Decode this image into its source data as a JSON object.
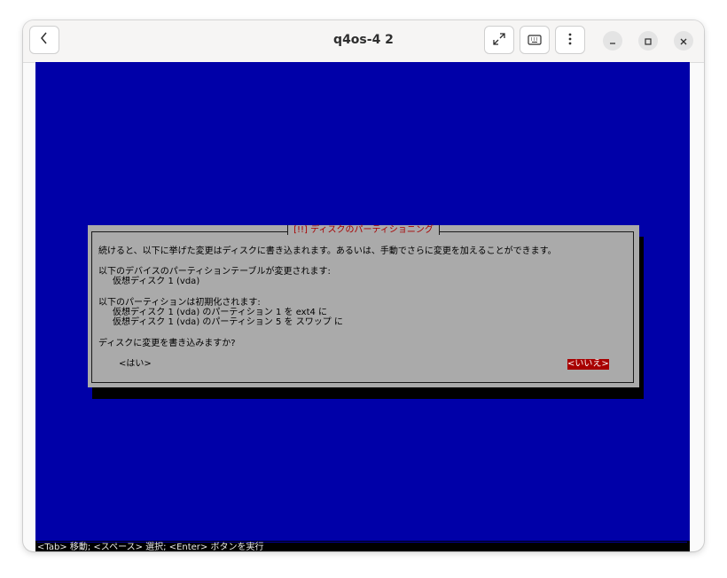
{
  "window": {
    "title": "q4os-4 2",
    "back_icon": "chevron-left-icon",
    "fullscreen_icon": "expand-arrows-icon",
    "keyboard_icon": "keyboard-icon",
    "menu_icon": "vertical-ellipsis-icon",
    "minimize_icon": "minimize-icon",
    "maximize_icon": "maximize-icon",
    "close_icon": "close-icon"
  },
  "dialog": {
    "title": "[!!] ディスクのパーティショニング",
    "line1": "続けると、以下に挙げた変更はディスクに書き込まれます。あるいは、手動でさらに変更を加えることができます。",
    "devices_heading": "以下のデバイスのパーティションテーブルが変更されます:",
    "device_1": "仮想ディスク 1 (vda)",
    "partitions_heading": "以下のパーティションは初期化されます:",
    "partition_1": "仮想ディスク 1 (vda) のパーティション 1 を ext4 に",
    "partition_2": "仮想ディスク 1 (vda) のパーティション 5 を スワップ に",
    "question": "ディスクに変更を書き込みますか?",
    "yes_label": "<はい>",
    "no_label": "<いいえ>"
  },
  "status_bar": "<Tab> 移動; <スペース> 選択; <Enter> ボタンを実行",
  "colors": {
    "installer_background": "#0000a8",
    "dialog_background": "#aaaaaa",
    "dialog_title": "#a80000",
    "selected_button": "#a80000"
  }
}
